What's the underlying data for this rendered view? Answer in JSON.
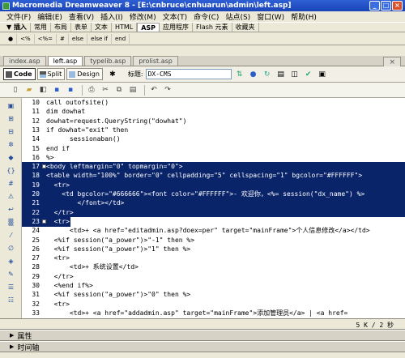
{
  "window": {
    "title": "Macromedia Dreamweaver 8 - [E:\\cnbruce\\cnhuarun\\admin\\left.asp]"
  },
  "menubar": [
    "文件(F)",
    "编辑(E)",
    "查看(V)",
    "插入(I)",
    "修改(M)",
    "文本(T)",
    "命令(C)",
    "站点(S)",
    "窗口(W)",
    "帮助(H)"
  ],
  "insert_panel": {
    "label": "▼ 插入",
    "tabs": [
      "常用",
      "布局",
      "表单",
      "文本",
      "HTML",
      "ASP",
      "应用程序",
      "Flash 元素",
      "收藏夹"
    ],
    "active_tab": "ASP",
    "buttons": [
      "●",
      "<%",
      "<%=",
      "#",
      "else",
      "else if",
      "end"
    ]
  },
  "document_tabs": [
    "index.asp",
    "left.asp",
    "typelib.asp",
    "prolist.asp"
  ],
  "active_document": "left.asp",
  "view_buttons": {
    "code": "Code",
    "split": "Split",
    "design": "Design"
  },
  "title_field": {
    "label": "标题:",
    "value": "DX-CMS"
  },
  "code_lines": [
    {
      "num": "10",
      "text": "call outofsite()",
      "sel": false
    },
    {
      "num": "11",
      "text": "dim dowhat",
      "sel": false
    },
    {
      "num": "12",
      "text": "dowhat=request.QueryString(\"dowhat\")",
      "sel": false
    },
    {
      "num": "13",
      "text": "if dowhat=\"exit\" then",
      "sel": false
    },
    {
      "num": "14",
      "text": "      sessionaban()",
      "sel": false
    },
    {
      "num": "15",
      "text": "end if",
      "sel": false
    },
    {
      "num": "16",
      "text": "%>",
      "sel": false
    },
    {
      "num": "17",
      "text": "<body leftmargin=\"0\" topmargin=\"0\">",
      "sel": true
    },
    {
      "num": "18",
      "text": "<table width=\"100%\" border=\"0\" cellpadding=\"5\" cellspacing=\"1\" bgcolor=\"#FFFFFF\">",
      "sel": true
    },
    {
      "num": "19",
      "text": "  <tr>",
      "sel": true
    },
    {
      "num": "20",
      "text": "    <td bgcolor=\"#666666\"><font color=\"#FFFFFF\">- 欢迎你，<%= session(\"dx_name\") %>",
      "sel": true
    },
    {
      "num": "21",
      "text": "        </font></td>",
      "sel": true
    },
    {
      "num": "22",
      "text": "  </tr>",
      "sel": true
    },
    {
      "num": "23",
      "text": "  <tr>",
      "sel": "partial"
    },
    {
      "num": "24",
      "text": "      <td>+ <a href=\"editadmin.asp?doex=per\" target=\"mainFrame\">个人信息修改</a></td>",
      "sel": false
    },
    {
      "num": "25",
      "text": "  <%if session(\"a_power\")>\"-1\" then %>",
      "sel": false
    },
    {
      "num": "26",
      "text": "  <%if session(\"a_power\")>\"1\" then %>",
      "sel": false
    },
    {
      "num": "27",
      "text": "  <tr>",
      "sel": false
    },
    {
      "num": "28",
      "text": "      <td>+ 系统设置</td>",
      "sel": false
    },
    {
      "num": "29",
      "text": "  </tr>",
      "sel": false
    },
    {
      "num": "30",
      "text": "  <%end if%>",
      "sel": false
    },
    {
      "num": "31",
      "text": "  <%if session(\"a_power\")>\"0\" then %>",
      "sel": false
    },
    {
      "num": "32",
      "text": "  <tr>",
      "sel": false
    },
    {
      "num": "33",
      "text": "      <td>+ <a href=\"addadmin.asp\" target=\"mainFrame\">添加管理员</a> | <a href=",
      "sel": false
    },
    {
      "num": "34",
      "text": "",
      "sel": false
    }
  ],
  "status": {
    "size": "5 K / 2 秒"
  },
  "panels": {
    "properties": "属性",
    "timeline": "时间轴"
  }
}
